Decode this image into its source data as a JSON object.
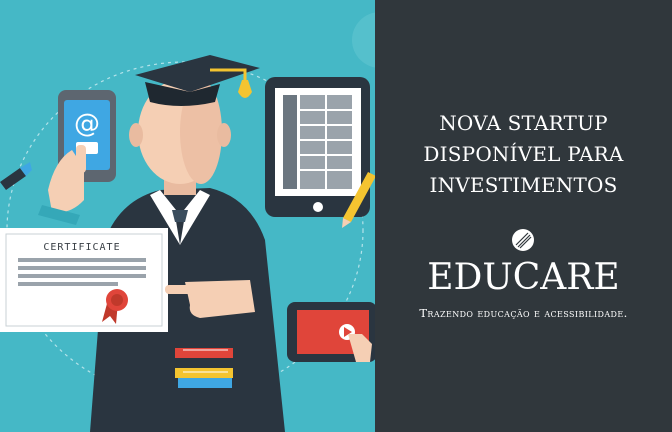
{
  "banner": {
    "headline_lines": [
      "NOVA STARTUP",
      "DISPONÍVEL PARA",
      "INVESTIMENTOS"
    ],
    "brand": "EDUCARE",
    "tagline": "Trazendo educação e acessibilidade."
  },
  "illustration": {
    "certificate_label": "CERTIFICATE",
    "email_symbol": "@"
  },
  "colors": {
    "left_background": "#45b8c6",
    "right_background": "#30373c",
    "text": "#ffffff",
    "gown": "#2a3540",
    "skin": "#f5cfb4",
    "tassel": "#f4c430",
    "ribbon": "#e0453a"
  }
}
